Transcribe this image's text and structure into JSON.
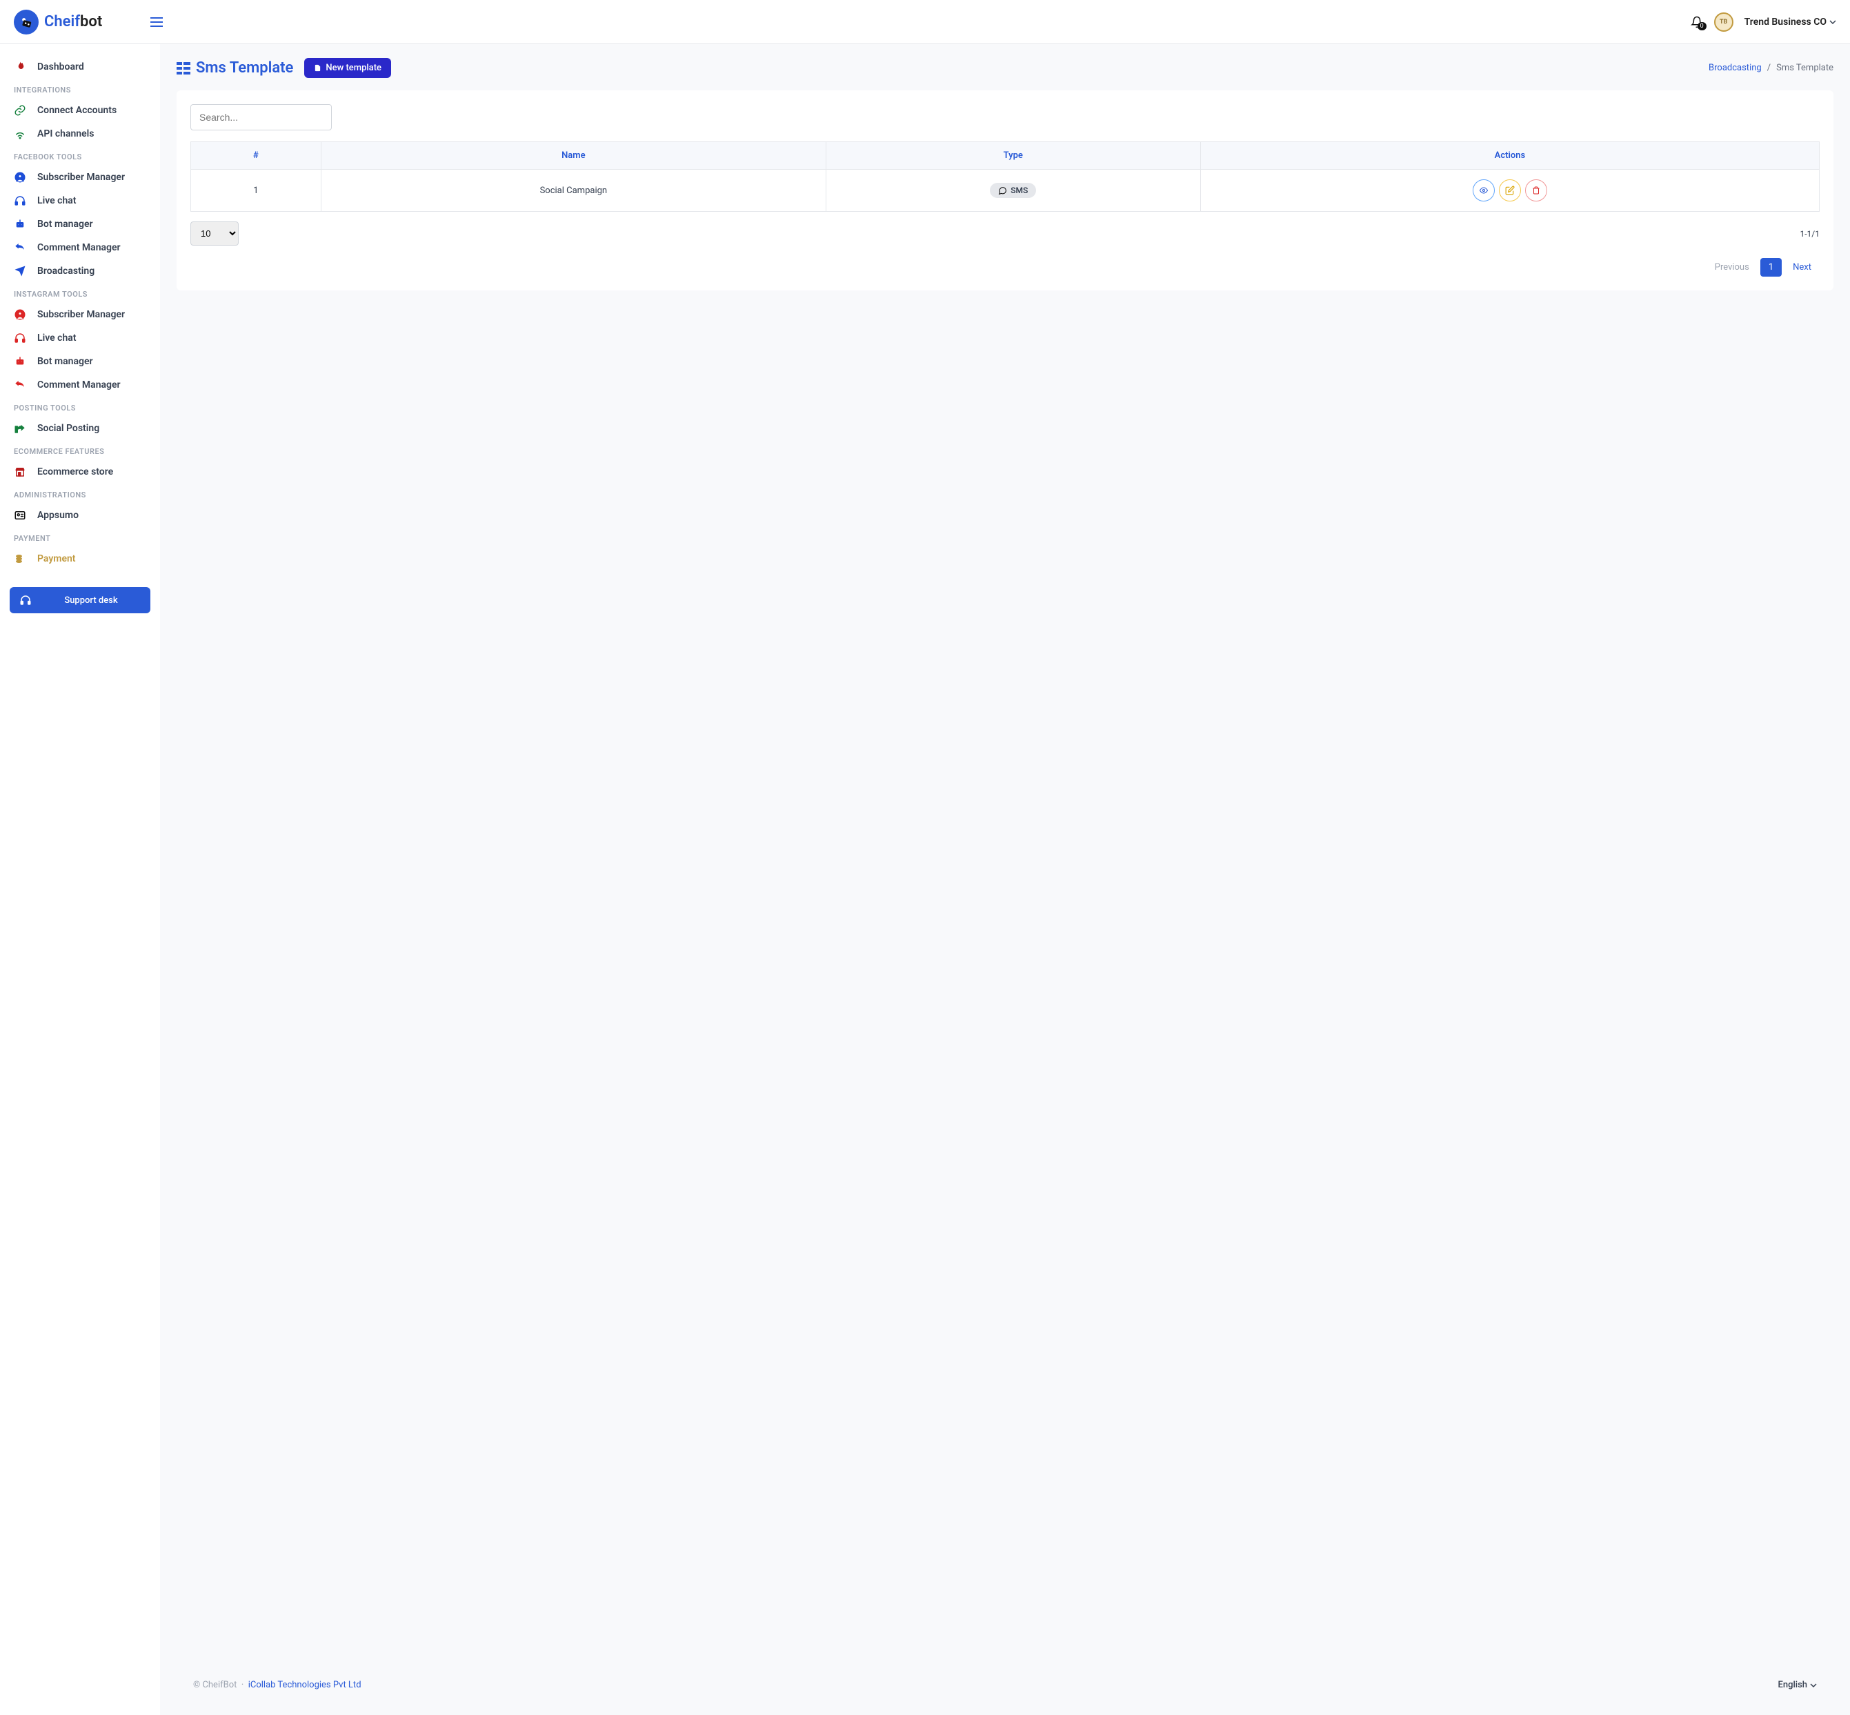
{
  "header": {
    "brand_prefix": "Cheif",
    "brand_suffix": "bot",
    "notification_count": "0",
    "user_name": "Trend Business CO"
  },
  "sidebar": {
    "items": [
      {
        "section": null,
        "label": "Dashboard",
        "icon": "fire",
        "color": "#b91c1c"
      },
      {
        "section": "Integrations"
      },
      {
        "label": "Connect Accounts",
        "icon": "link",
        "color": "#15803d"
      },
      {
        "label": "API channels",
        "icon": "wifi",
        "color": "#15803d"
      },
      {
        "section": "Facebook Tools"
      },
      {
        "label": "Subscriber Manager",
        "icon": "user-circle",
        "color": "#1d4ed8"
      },
      {
        "label": "Live chat",
        "icon": "headset",
        "color": "#1d4ed8"
      },
      {
        "label": "Bot manager",
        "icon": "robot",
        "color": "#1d4ed8"
      },
      {
        "label": "Comment Manager",
        "icon": "reply",
        "color": "#1d4ed8"
      },
      {
        "label": "Broadcasting",
        "icon": "send",
        "color": "#1d4ed8"
      },
      {
        "section": "Instagram Tools"
      },
      {
        "label": "Subscriber Manager",
        "icon": "user-circle",
        "color": "#dc2626"
      },
      {
        "label": "Live chat",
        "icon": "headset",
        "color": "#dc2626"
      },
      {
        "label": "Bot manager",
        "icon": "robot",
        "color": "#dc2626"
      },
      {
        "label": "Comment Manager",
        "icon": "reply",
        "color": "#dc2626"
      },
      {
        "section": "Posting Tools"
      },
      {
        "label": "Social Posting",
        "icon": "share",
        "color": "#15803d"
      },
      {
        "section": "Ecommerce Features"
      },
      {
        "label": "Ecommerce store",
        "icon": "store",
        "color": "#b91c1c"
      },
      {
        "section": "Administrations"
      },
      {
        "label": "Appsumo",
        "icon": "id-card",
        "color": "#111"
      },
      {
        "section": "Payment"
      },
      {
        "label": "Payment",
        "icon": "coins",
        "color": "#c19a3f",
        "payment": true
      }
    ],
    "support_label": "Support desk"
  },
  "page": {
    "title": "Sms Template",
    "new_button": "New template",
    "breadcrumbs": {
      "parent": "Broadcasting",
      "current": "Sms Template"
    }
  },
  "table": {
    "search_placeholder": "Search...",
    "columns": {
      "id": "#",
      "name": "Name",
      "type": "Type",
      "actions": "Actions"
    },
    "rows": [
      {
        "id": "1",
        "name": "Social Campaign",
        "type": "SMS"
      }
    ],
    "page_size": "10",
    "range": "1-1/1",
    "prev": "Previous",
    "next": "Next",
    "current_page": "1"
  },
  "footer": {
    "copyright": "© CheifBot",
    "separator": "·",
    "company": "iCollab Technologies Pvt Ltd",
    "language": "English"
  }
}
